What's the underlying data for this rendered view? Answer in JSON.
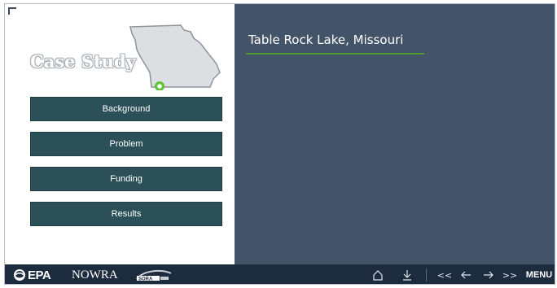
{
  "case_study": {
    "title": "Case Study"
  },
  "nav": {
    "items": [
      {
        "label": "Background"
      },
      {
        "label": "Problem"
      },
      {
        "label": "Funding"
      },
      {
        "label": "Results"
      }
    ]
  },
  "slide": {
    "title": "Table Rock Lake, Missouri"
  },
  "footer": {
    "logos": {
      "epa": "EPA",
      "nowra": "NOWRA",
      "sora": "SORA"
    },
    "controls": {
      "home_icon": "home-icon",
      "download_icon": "download-icon",
      "first_label": "<<",
      "prev_icon": "arrow-left-icon",
      "next_icon": "arrow-right-icon",
      "last_label": ">>",
      "menu_label": "MENU"
    }
  },
  "colors": {
    "button": "#2c5058",
    "content_bg": "#435469",
    "accent": "#4e9a2c",
    "footer_bg": "#1d2b3f",
    "map_marker": "#5ec43a"
  }
}
